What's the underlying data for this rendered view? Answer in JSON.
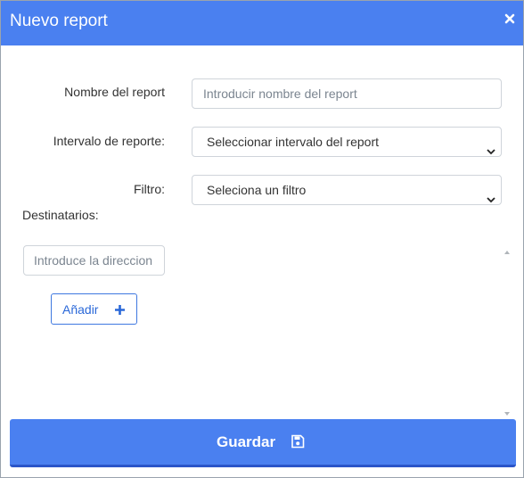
{
  "dialog": {
    "title": "Nuevo report",
    "close_icon": "close-icon"
  },
  "form": {
    "name_label": "Nombre del report",
    "name_placeholder": "Introducir nombre del report",
    "name_value": "",
    "interval_label": "Intervalo de reporte:",
    "interval_selected": "Seleccionar intervalo del report",
    "filter_label": "Filtro:",
    "filter_selected": "Seleciona un filtro",
    "recipients_label": "Destinatarios:",
    "recipient_placeholder": "Introduce la direccion",
    "recipient_value": "",
    "add_label": "Añadir",
    "add_icon": "plus-icon"
  },
  "footer": {
    "save_label": "Guardar",
    "save_icon": "floppy-disk-icon"
  },
  "colors": {
    "header_bg": "#4a80f0",
    "save_bg": "#4a80f0",
    "add_border": "#3f78e0"
  }
}
